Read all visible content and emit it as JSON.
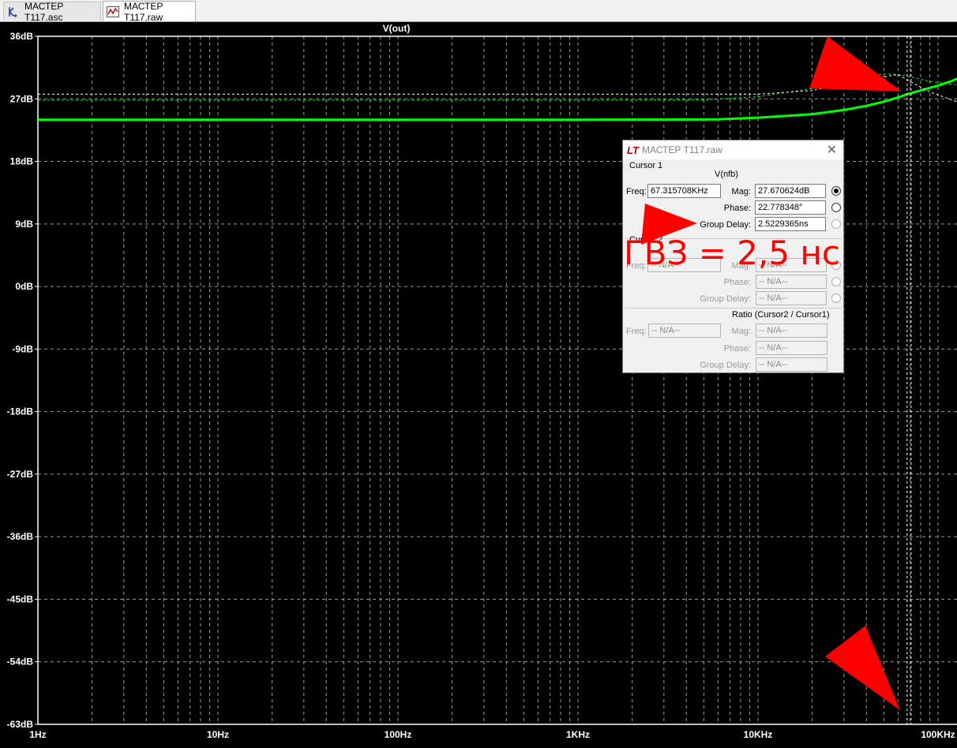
{
  "tabs": [
    {
      "label": "МАСТЕР Т117.asc",
      "icon": "schematic-icon",
      "active": false
    },
    {
      "label": "МАСТЕР Т117.raw",
      "icon": "waveform-icon",
      "active": true
    }
  ],
  "plot": {
    "trace_label": "V(out)",
    "y_ticks": [
      "36dB",
      "27dB",
      "18dB",
      "9dB",
      "0dB",
      "-9dB",
      "-18dB",
      "-27dB",
      "-36dB",
      "-45dB",
      "-54dB",
      "-63dB"
    ],
    "x_ticks": [
      "1Hz",
      "10Hz",
      "100Hz",
      "1KHz",
      "10KHz",
      "100KHz"
    ],
    "colors": {
      "background": "#000000",
      "grid": "#9a9a9a",
      "trace": "#00ff00",
      "cursor": "#ffffff"
    }
  },
  "chart_data": {
    "type": "line",
    "xscale": "log",
    "xlim": [
      1,
      130000
    ],
    "ylim": [
      -63,
      36
    ],
    "xlabel": "",
    "ylabel": "",
    "grid": true,
    "series": [
      {
        "name": "V(out)",
        "style": "solid-thick",
        "color": "#00ff00",
        "points": [
          [
            1,
            24
          ],
          [
            100,
            24
          ],
          [
            1000,
            24
          ],
          [
            6000,
            24.05
          ],
          [
            10000,
            24.3
          ],
          [
            20000,
            24.8
          ],
          [
            30000,
            25.4
          ],
          [
            40000,
            26.0
          ],
          [
            50000,
            26.6
          ],
          [
            60000,
            27.2
          ],
          [
            67315.7,
            27.67
          ],
          [
            80000,
            28.2
          ],
          [
            100000,
            28.9
          ],
          [
            120000,
            29.6
          ],
          [
            130000,
            30.0
          ]
        ]
      },
      {
        "name": "",
        "style": "dashed",
        "color": "#00ff00",
        "points": [
          [
            1,
            26.8
          ],
          [
            1000,
            26.8
          ],
          [
            5000,
            26.85
          ],
          [
            10000,
            27.3
          ],
          [
            20000,
            28.5
          ],
          [
            30000,
            29.6
          ],
          [
            40000,
            30.3
          ],
          [
            50000,
            30.6
          ],
          [
            60000,
            30.5
          ],
          [
            70000,
            30.2
          ],
          [
            90000,
            29.5
          ],
          [
            130000,
            29.0
          ]
        ]
      },
      {
        "name": "",
        "style": "dashed",
        "color": "#ffffff",
        "points": [
          [
            1,
            27.67
          ],
          [
            10000,
            27.67
          ],
          [
            20000,
            28.2
          ],
          [
            40000,
            29.8
          ],
          [
            60000,
            30.5
          ],
          [
            70000,
            29.5
          ],
          [
            90000,
            28.0
          ],
          [
            130000,
            26.5
          ]
        ]
      }
    ],
    "cursor_x": 67315.7
  },
  "cursor_dialog": {
    "title": "МАСТЕР Т117.raw",
    "close_label": "✕",
    "cursor1": {
      "group_label": "Cursor 1",
      "trace": "V(nfb)",
      "freq_label": "Freq:",
      "freq": "67.315708KHz",
      "mag_label": "Mag:",
      "mag": "27.670624dB",
      "phase_label": "Phase:",
      "phase": "22.778348°",
      "gd_label": "Group Delay:",
      "gd": "2.5229365ns"
    },
    "cursor2": {
      "group_label": "Cursor 2",
      "freq_label": "Freq:",
      "freq": "-- N/A--",
      "mag_label": "Mag:",
      "mag": "-- N/A--",
      "phase_label": "Phase:",
      "phase": "-- N/A--",
      "gd_label": "Group Delay:",
      "gd": "-- N/A--"
    },
    "ratio": {
      "group_label": "Ratio (Cursor2 / Cursor1)",
      "freq_label": "Freq:",
      "freq": "-- N/A--",
      "mag_label": "Mag:",
      "mag": "-- N/A--",
      "phase_label": "Phase:",
      "phase": "-- N/A--",
      "gd_label": "Group Delay:",
      "gd": "-- N/A--"
    }
  },
  "annotation": {
    "text": "ГВЗ = 2,5 нс",
    "color": "#ff0000"
  }
}
